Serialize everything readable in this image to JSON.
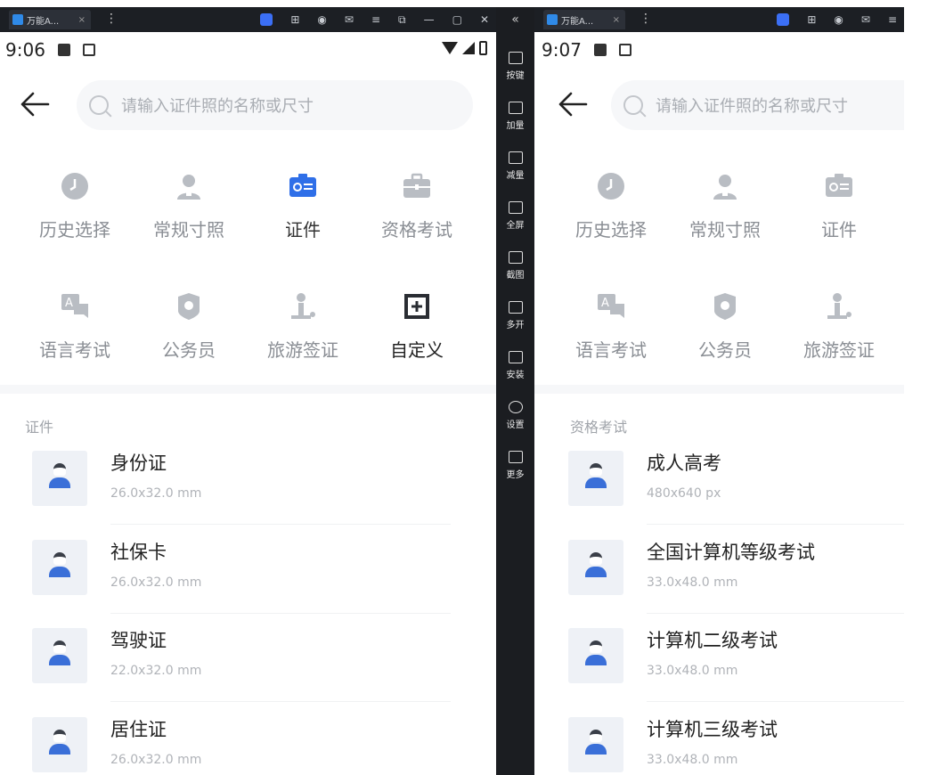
{
  "left": {
    "titlebar": {
      "tab_title": "万能A...",
      "tab_close": "×",
      "menu": "⋮",
      "controls": [
        "—",
        "▢",
        "✕"
      ]
    },
    "status": {
      "time": "9:06"
    },
    "search": {
      "placeholder": "请输入证件照的名称或尺寸"
    },
    "categories": [
      {
        "label": "历史选择",
        "icon": "clock-icon"
      },
      {
        "label": "常规寸照",
        "icon": "person-badge-icon"
      },
      {
        "label": "证件",
        "icon": "id-card-icon",
        "active": true
      },
      {
        "label": "资格考试",
        "icon": "briefcase-icon"
      },
      {
        "label": "语言考试",
        "icon": "speech-bubble-icon"
      },
      {
        "label": "公务员",
        "icon": "shield-icon"
      },
      {
        "label": "旅游签证",
        "icon": "traveler-icon"
      },
      {
        "label": "自定义",
        "icon": "custom-frame-icon"
      }
    ],
    "section_title": "证件",
    "items": [
      {
        "name": "身份证",
        "size": "26.0x32.0 mm"
      },
      {
        "name": "社保卡",
        "size": "26.0x32.0 mm"
      },
      {
        "name": "驾驶证",
        "size": "22.0x32.0 mm"
      },
      {
        "name": "居住证",
        "size": "26.0x32.0 mm"
      }
    ]
  },
  "toolbar": {
    "collapse": "«",
    "buttons": [
      {
        "label": "按键",
        "icon": "keyboard-icon"
      },
      {
        "label": "加量",
        "icon": "volume-up-icon"
      },
      {
        "label": "减量",
        "icon": "volume-down-icon"
      },
      {
        "label": "全屏",
        "icon": "fullscreen-icon"
      },
      {
        "label": "截图",
        "icon": "scissors-icon"
      },
      {
        "label": "多开",
        "icon": "multi-window-icon"
      },
      {
        "label": "安装",
        "icon": "install-icon"
      },
      {
        "label": "设置",
        "icon": "settings-icon"
      },
      {
        "label": "更多",
        "icon": "more-icon"
      }
    ]
  },
  "right": {
    "titlebar": {
      "tab_title": "万能A...",
      "tab_close": "×",
      "menu": "⋮"
    },
    "status": {
      "time": "9:07"
    },
    "search": {
      "placeholder": "请输入证件照的名称或尺寸"
    },
    "categories": [
      {
        "label": "历史选择",
        "icon": "clock-icon"
      },
      {
        "label": "常规寸照",
        "icon": "person-badge-icon"
      },
      {
        "label": "证件",
        "icon": "id-card-icon"
      },
      {
        "label": "语言考试",
        "icon": "speech-bubble-icon"
      },
      {
        "label": "公务员",
        "icon": "shield-icon"
      },
      {
        "label": "旅游签证",
        "icon": "traveler-icon"
      }
    ],
    "section_title": "资格考试",
    "items": [
      {
        "name": "成人高考",
        "size": "480x640 px"
      },
      {
        "name": "全国计算机等级考试",
        "size": "33.0x48.0 mm"
      },
      {
        "name": "计算机二级考试",
        "size": "33.0x48.0 mm"
      },
      {
        "name": "计算机三级考试",
        "size": "33.0x48.0 mm"
      }
    ]
  },
  "colors": {
    "accent": "#2f6fe8",
    "icon_gray": "#b9bdc3",
    "text_dark": "#222222",
    "text_gray": "#8a8e94"
  }
}
